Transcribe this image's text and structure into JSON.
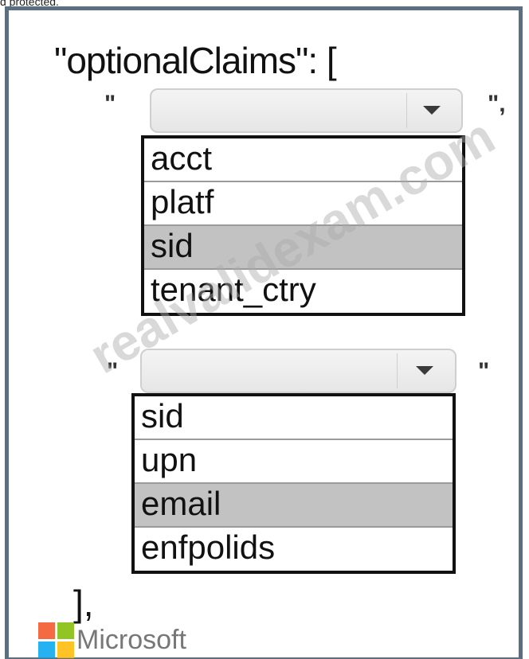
{
  "top_text": "d protected.",
  "heading": "\"optionalClaims\": [",
  "quote_open": "\"",
  "quote_close_comma": "\",",
  "quote_close": "\"",
  "dropdown1": {
    "value": "",
    "options": [
      "acct",
      "platf",
      "sid",
      "tenant_ctry"
    ],
    "highlighted": "sid"
  },
  "dropdown2": {
    "value": "",
    "options": [
      "sid",
      "upn",
      "email",
      "enfpolids"
    ],
    "highlighted": "email"
  },
  "closing": "],",
  "brand": "Microsoft",
  "watermark": "realvalidexam.com",
  "colors": {
    "frame": "#5c6f80",
    "highlight": "#c2c2c2",
    "logo_red": "#f25022",
    "logo_green": "#7fba00",
    "logo_blue": "#00a4ef",
    "logo_yellow": "#ffb900"
  }
}
